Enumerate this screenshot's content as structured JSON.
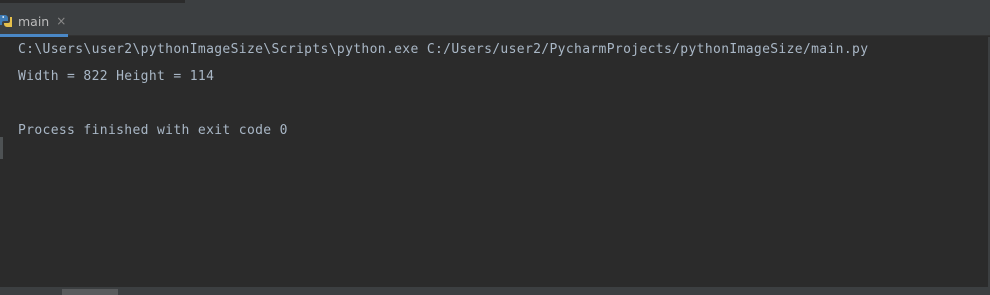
{
  "tabs": [
    {
      "label": "main",
      "icon": "python-file-icon",
      "active": true,
      "close_glyph": "×"
    }
  ],
  "console": {
    "lines": [
      "C:\\Users\\user2\\pythonImageSize\\Scripts\\python.exe C:/Users/user2/PycharmProjects/pythonImageSize/main.py",
      "Width = 822 Height = 114",
      "",
      "Process finished with exit code 0"
    ]
  },
  "colors": {
    "background": "#2b2b2b",
    "panel": "#3c3f41",
    "text": "#a9b7c6",
    "tab_accent": "#4a88c7"
  }
}
